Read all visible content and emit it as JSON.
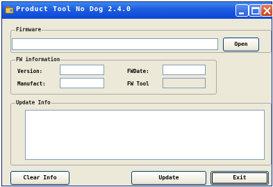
{
  "window": {
    "title": "Product Tool No Dog 2.4.0"
  },
  "firmware": {
    "legend": "Firmware",
    "path_value": "",
    "open_label": "Open"
  },
  "fw_info": {
    "legend": "FW information",
    "version_label": "Version:",
    "version_value": "",
    "manufact_label": "Manufact:",
    "manufact_value": "",
    "fwdate_label": "FWDate:",
    "fwdate_value": "",
    "fwtool_label": "FW Tool",
    "fwtool_value": ""
  },
  "update": {
    "legend": "Update Info",
    "text": ""
  },
  "buttons": {
    "clear_info": "Clear Info",
    "update": "Update",
    "exit": "Exit"
  }
}
